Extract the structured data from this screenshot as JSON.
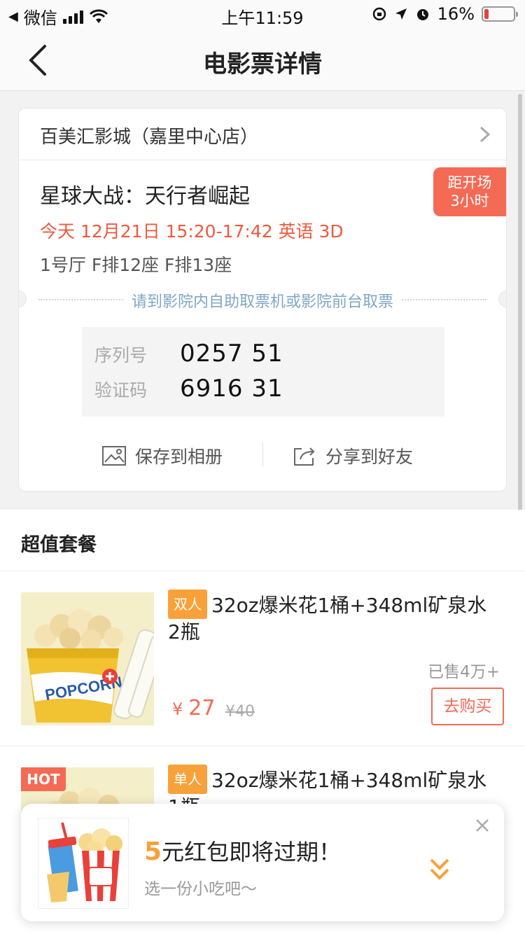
{
  "status_bar": {
    "back_app": "微信",
    "time": "上午11:59",
    "battery": "16%",
    "battery_level": 0.16,
    "battery_color": "#e8403a"
  },
  "nav": {
    "title": "电影票详情",
    "back_icon": "chevron-left-icon"
  },
  "ticket": {
    "cinema": "百美汇影城（嘉里中心店）",
    "countdown_line1": "距开场",
    "countdown_line2": "3小时",
    "movie": "星球大战：天行者崛起",
    "showtime": "今天 12月21日 15:20-17:42  英语 3D",
    "seats": "1号厅 F排12座 F排13座",
    "pickup_tip": "请到影院内自助取票机或影院前台取票",
    "serial_label": "序列号",
    "serial_value": "0257 51",
    "verify_label": "验证码",
    "verify_value": "6916 31",
    "save_label": "保存到相册",
    "share_label": "分享到好友"
  },
  "combos": {
    "section_title": "超值套餐",
    "items": [
      {
        "tag": "双人",
        "name": "32oz爆米花1桶+348ml矿泉水2瓶",
        "sold": "已售4万+",
        "currency": "¥",
        "price": "27",
        "old_price": "¥40",
        "buy_label": "去购买"
      },
      {
        "hot": "HOT",
        "tag": "单人",
        "name": "32oz爆米花1桶+348ml矿泉水1瓶"
      }
    ]
  },
  "popup": {
    "amount": "5",
    "headline": "元红包即将过期！",
    "sub": "选一份小吃吧～"
  },
  "colors": {
    "accent": "#f46a55",
    "tag": "#f8a13a",
    "tip": "#7fa7c4"
  }
}
